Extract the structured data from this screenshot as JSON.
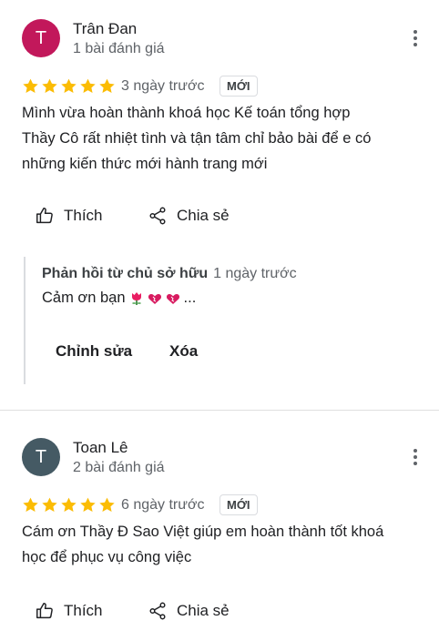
{
  "reviews": [
    {
      "avatar_letter": "T",
      "avatar_color": "#c2185b",
      "name": "Trân Đan",
      "review_count": "1 bài đánh giá",
      "rating": 5,
      "date": "3 ngày trước",
      "badge": "MỚI",
      "text": [
        "Mình vừa hoàn thành khoá học Kế toán tổng hợp",
        "Thầy Cô rất nhiệt tình và tận tâm chỉ bảo bài  để e có",
        "những kiến thức mới hành trang mới"
      ],
      "like_label": "Thích",
      "share_label": "Chia sẻ",
      "owner_reply": {
        "title": "Phản hồi từ chủ sở hữu",
        "date": "1 ngày trước",
        "text": "Cảm ơn bạn",
        "suffix": "...",
        "edit_label": "Chỉnh sửa",
        "delete_label": "Xóa"
      }
    },
    {
      "avatar_letter": "T",
      "avatar_color": "#455a64",
      "name": "Toan Lê",
      "review_count": "2 bài đánh giá",
      "rating": 5,
      "date": "6 ngày trước",
      "badge": "MỚI",
      "text": [
        "Cám ơn Thầy Đ Sao Việt giúp em hoàn thành tốt khoá",
        "học để phục vụ công việc"
      ],
      "like_label": "Thích",
      "share_label": "Chia sẻ"
    }
  ],
  "colors": {
    "star": "#fbbc04",
    "secondary_text": "#5f6368"
  },
  "icons": [
    "thumb-up-icon",
    "share-icon",
    "more-vert-icon",
    "star-icon",
    "tulip-emoji",
    "heart-emoji"
  ]
}
